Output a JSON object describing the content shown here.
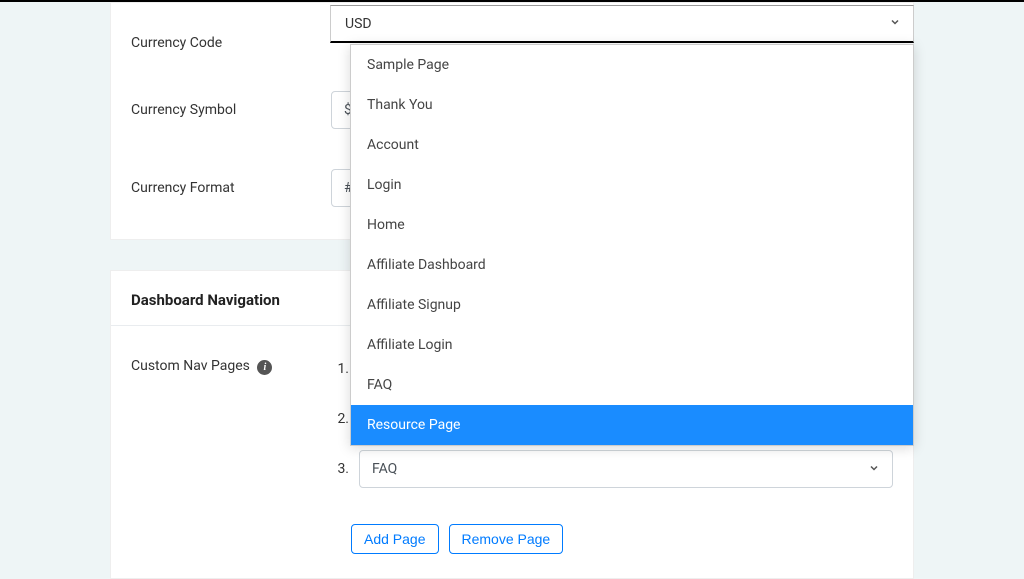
{
  "currency": {
    "code_label": "Currency Code",
    "code_value": "USD",
    "symbol_label": "Currency Symbol",
    "symbol_value": "$",
    "format_label": "Currency Format",
    "format_value": "#,###.##"
  },
  "dashboard_nav": {
    "title": "Dashboard Navigation",
    "custom_pages_label": "Custom Nav Pages",
    "items": [
      {
        "num": "1.",
        "value": ""
      },
      {
        "num": "2.",
        "value": ""
      },
      {
        "num": "3.",
        "value": "FAQ"
      }
    ],
    "add_page_label": "Add Page",
    "remove_page_label": "Remove Page"
  },
  "dropdown": {
    "options": [
      "Sample Page",
      "Thank You",
      "Account",
      "Login",
      "Home",
      "Affiliate Dashboard",
      "Affiliate Signup",
      "Affiliate Login",
      "FAQ",
      "Resource Page"
    ],
    "highlighted_index": 9
  }
}
